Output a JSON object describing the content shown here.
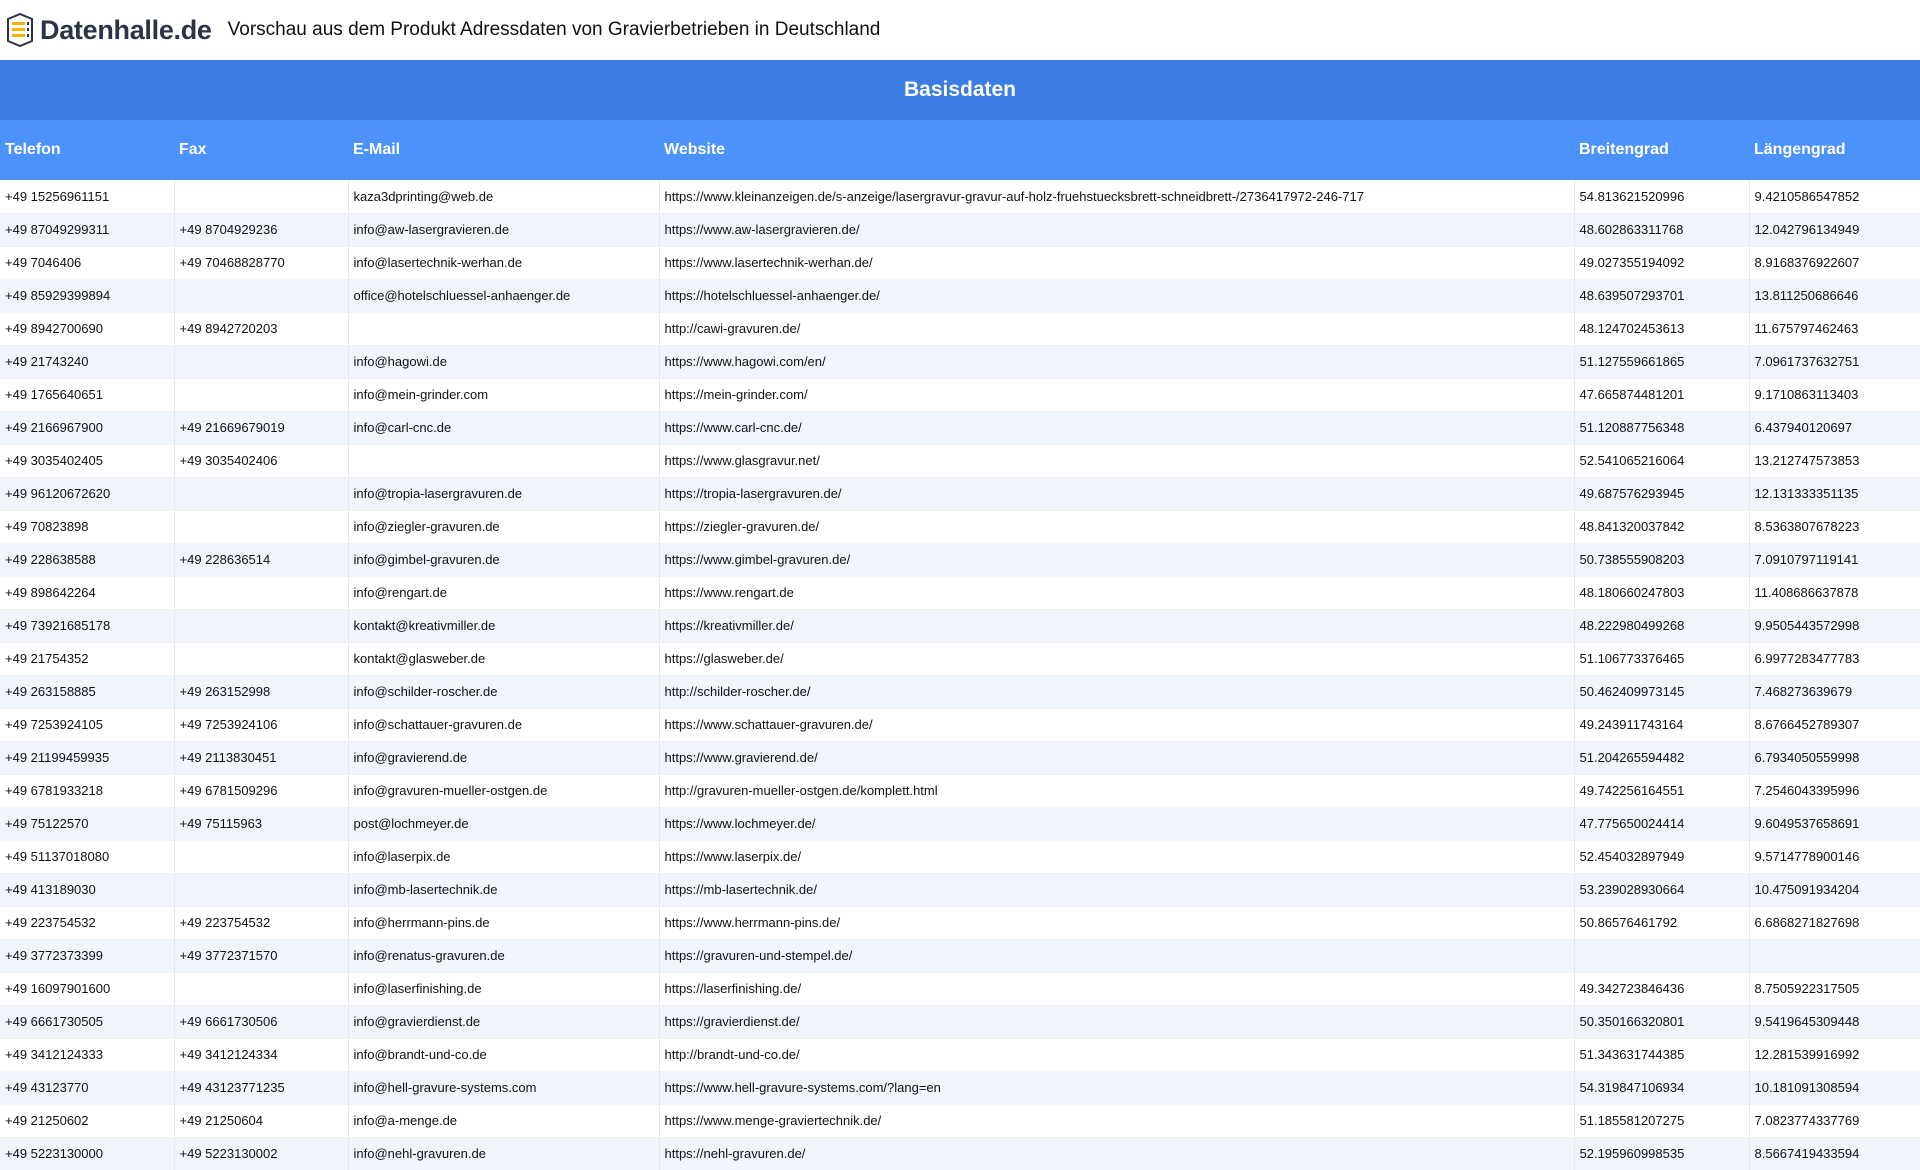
{
  "header": {
    "logo_text": "Datenhalle.de",
    "title": "Vorschau aus dem Produkt Adressdaten von Gravierbetrieben in Deutschland"
  },
  "table": {
    "section_title": "Basisdaten",
    "columns": [
      "Telefon",
      "Fax",
      "E-Mail",
      "Website",
      "Breitengrad",
      "Längengrad"
    ],
    "rows": [
      [
        "+49 15256961151",
        "",
        "kaza3dprinting@web.de",
        "https://www.kleinanzeigen.de/s-anzeige/lasergravur-gravur-auf-holz-fruehstuecksbrett-schneidbrett-/2736417972-246-717",
        "54.813621520996",
        "9.4210586547852"
      ],
      [
        "+49 87049299311",
        "+49 8704929236",
        "info@aw-lasergravieren.de",
        "https://www.aw-lasergravieren.de/",
        "48.602863311768",
        "12.042796134949"
      ],
      [
        "+49 7046406",
        "+49 70468828770",
        "info@lasertechnik-werhan.de",
        "https://www.lasertechnik-werhan.de/",
        "49.027355194092",
        "8.9168376922607"
      ],
      [
        "+49 85929399894",
        "",
        "office@hotelschluessel-anhaenger.de",
        "https://hotelschluessel-anhaenger.de/",
        "48.639507293701",
        "13.811250686646"
      ],
      [
        "+49 8942700690",
        "+49 8942720203",
        "",
        "http://cawi-gravuren.de/",
        "48.124702453613",
        "11.675797462463"
      ],
      [
        "+49 21743240",
        "",
        "info@hagowi.de",
        "https://www.hagowi.com/en/",
        "51.127559661865",
        "7.0961737632751"
      ],
      [
        "+49 1765640651",
        "",
        "info@mein-grinder.com",
        "https://mein-grinder.com/",
        "47.665874481201",
        "9.1710863113403"
      ],
      [
        "+49 2166967900",
        "+49 21669679019",
        "info@carl-cnc.de",
        "https://www.carl-cnc.de/",
        "51.120887756348",
        "6.437940120697"
      ],
      [
        "+49 3035402405",
        "+49 3035402406",
        "",
        "https://www.glasgravur.net/",
        "52.541065216064",
        "13.212747573853"
      ],
      [
        "+49 96120672620",
        "",
        "info@tropia-lasergravuren.de",
        "https://tropia-lasergravuren.de/",
        "49.687576293945",
        "12.131333351135"
      ],
      [
        "+49 70823898",
        "",
        "info@ziegler-gravuren.de",
        "https://ziegler-gravuren.de/",
        "48.841320037842",
        "8.5363807678223"
      ],
      [
        "+49 228638588",
        "+49 228636514",
        "info@gimbel-gravuren.de",
        "https://www.gimbel-gravuren.de/",
        "50.738555908203",
        "7.0910797119141"
      ],
      [
        "+49 898642264",
        "",
        "info@rengart.de",
        "https://www.rengart.de",
        "48.180660247803",
        "11.408686637878"
      ],
      [
        "+49 73921685178",
        "",
        "kontakt@kreativmiller.de",
        "https://kreativmiller.de/",
        "48.222980499268",
        "9.9505443572998"
      ],
      [
        "+49 21754352",
        "",
        "kontakt@glasweber.de",
        "https://glasweber.de/",
        "51.106773376465",
        "6.9977283477783"
      ],
      [
        "+49 263158885",
        "+49 263152998",
        "info@schilder-roscher.de",
        "http://schilder-roscher.de/",
        "50.462409973145",
        "7.468273639679"
      ],
      [
        "+49 7253924105",
        "+49 7253924106",
        "info@schattauer-gravuren.de",
        "https://www.schattauer-gravuren.de/",
        "49.243911743164",
        "8.6766452789307"
      ],
      [
        "+49 21199459935",
        "+49 2113830451",
        "info@gravierend.de",
        "https://www.gravierend.de/",
        "51.204265594482",
        "6.7934050559998"
      ],
      [
        "+49 6781933218",
        "+49 6781509296",
        "info@gravuren-mueller-ostgen.de",
        "http://gravuren-mueller-ostgen.de/komplett.html",
        "49.742256164551",
        "7.2546043395996"
      ],
      [
        "+49 75122570",
        "+49 75115963",
        "post@lochmeyer.de",
        "https://www.lochmeyer.de/",
        "47.775650024414",
        "9.6049537658691"
      ],
      [
        "+49 51137018080",
        "",
        "info@laserpix.de",
        "https://www.laserpix.de/",
        "52.454032897949",
        "9.5714778900146"
      ],
      [
        "+49 413189030",
        "",
        "info@mb-lasertechnik.de",
        "https://mb-lasertechnik.de/",
        "53.239028930664",
        "10.475091934204"
      ],
      [
        "+49 223754532",
        "+49 223754532",
        "info@herrmann-pins.de",
        "https://www.herrmann-pins.de/",
        "50.86576461792",
        "6.6868271827698"
      ],
      [
        "+49 3772373399",
        "+49 3772371570",
        "info@renatus-gravuren.de",
        "https://gravuren-und-stempel.de/",
        "",
        ""
      ],
      [
        "+49 16097901600",
        "",
        "info@laserfinishing.de",
        "https://laserfinishing.de/",
        "49.342723846436",
        "8.7505922317505"
      ],
      [
        "+49 6661730505",
        "+49 6661730506",
        "info@gravierdienst.de",
        "https://gravierdienst.de/",
        "50.350166320801",
        "9.5419645309448"
      ],
      [
        "+49 3412124333",
        "+49 3412124334",
        "info@brandt-und-co.de",
        "http://brandt-und-co.de/",
        "51.343631744385",
        "12.281539916992"
      ],
      [
        "+49 43123770",
        "+49 43123771235",
        "info@hell-gravure-systems.com",
        "https://www.hell-gravure-systems.com/?lang=en",
        "54.319847106934",
        "10.181091308594"
      ],
      [
        "+49 21250602",
        "+49 21250604",
        "info@a-menge.de",
        "https://www.menge-graviertechnik.de/",
        "51.185581207275",
        "7.0823774337769"
      ],
      [
        "+49 5223130000",
        "+49 5223130002",
        "info@nehl-gravuren.de",
        "https://nehl-gravuren.de/",
        "52.195960998535",
        "8.5667419433594"
      ]
    ]
  }
}
